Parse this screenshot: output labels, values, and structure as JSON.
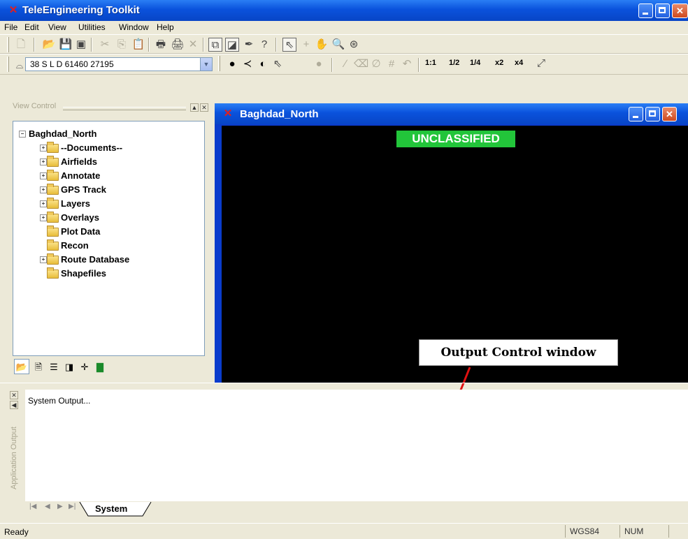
{
  "app": {
    "title": "TeleEngineering Toolkit"
  },
  "menu": [
    "File",
    "Edit",
    "View",
    "Utilities",
    "Window",
    "Help"
  ],
  "coordinate": {
    "value": "38 S L D 61460 27195"
  },
  "zoom_buttons": [
    "1:1",
    "1/2",
    "1/4",
    "x2",
    "x4"
  ],
  "view_control": {
    "title": "View Control",
    "root": "Baghdad_North",
    "items": [
      {
        "label": "--Documents--",
        "expandable": true
      },
      {
        "label": "Airfields",
        "expandable": true
      },
      {
        "label": "Annotate",
        "expandable": true
      },
      {
        "label": "GPS Track",
        "expandable": true
      },
      {
        "label": "Layers",
        "expandable": true
      },
      {
        "label": "Overlays",
        "expandable": true
      },
      {
        "label": "Plot Data",
        "expandable": false
      },
      {
        "label": "Recon",
        "expandable": false
      },
      {
        "label": "Route Database",
        "expandable": true
      },
      {
        "label": "Shapefiles",
        "expandable": false
      }
    ]
  },
  "map_window": {
    "title": "Baghdad_North",
    "banner": "UNCLASSIFIED",
    "banner_color": "#22c53a"
  },
  "callout": {
    "text": "Output Control window",
    "arrow_color": "#e01010"
  },
  "output": {
    "text": "System Output...",
    "side_label": "Application Output",
    "active_tab": "System"
  },
  "status": {
    "ready": "Ready",
    "datum": "WGS84",
    "num": "NUM"
  },
  "colors": {
    "titlebar": "#0a52dc",
    "chrome": "#ece9d8",
    "map_bg": "#000000"
  }
}
